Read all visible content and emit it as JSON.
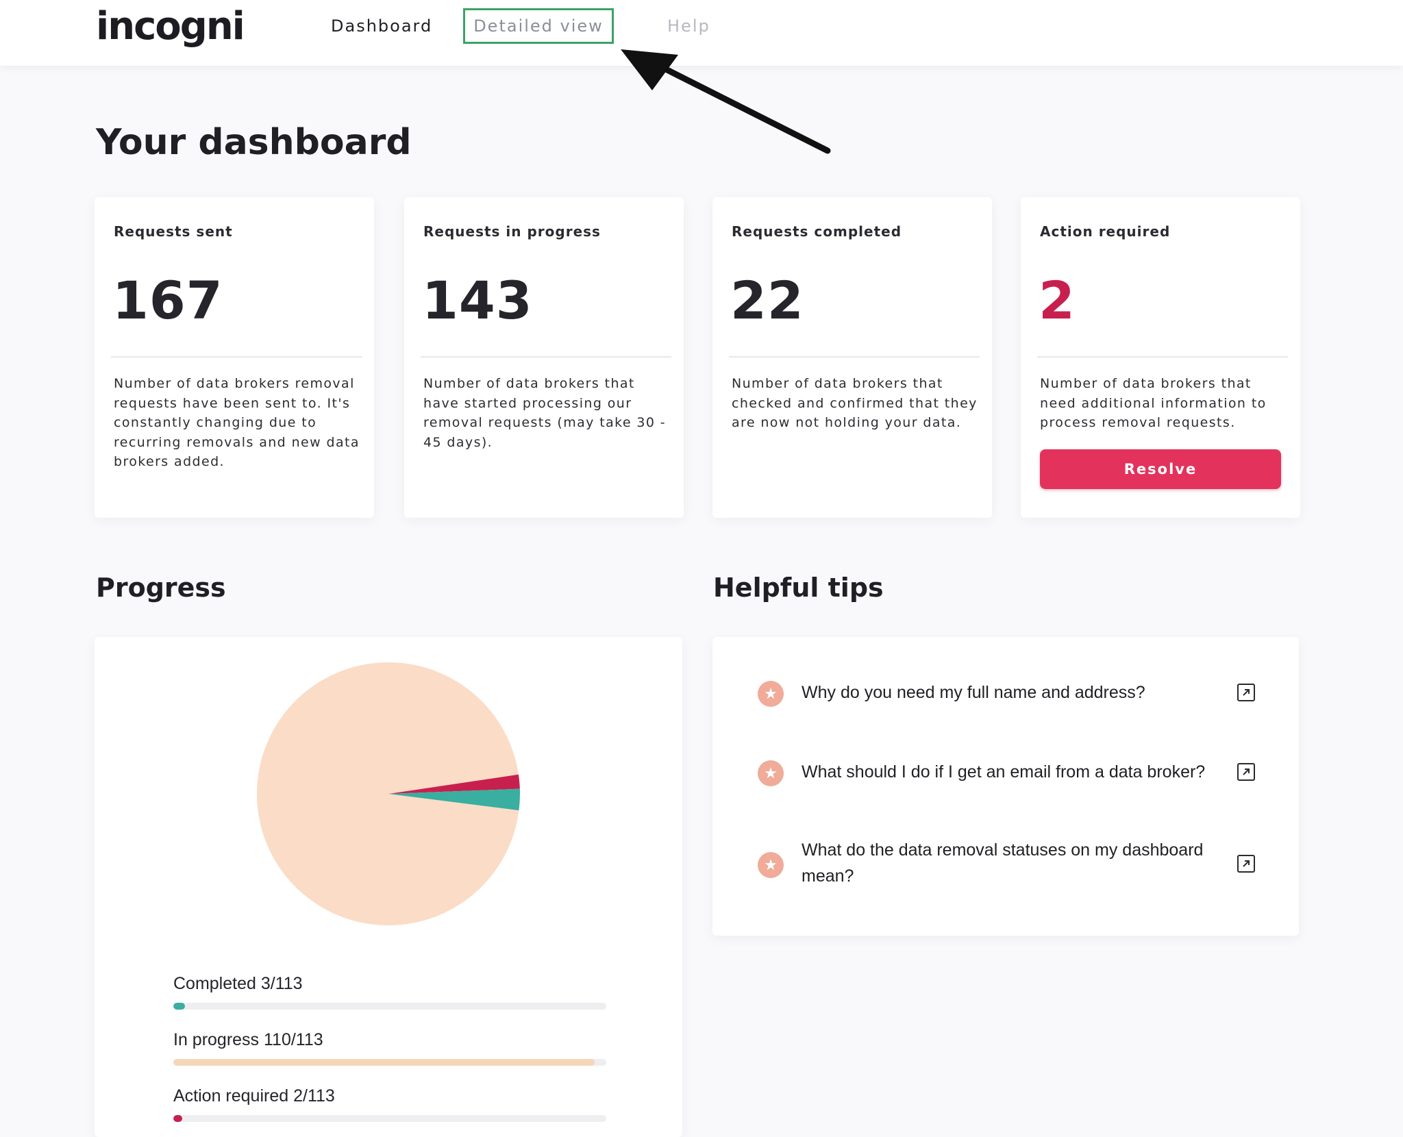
{
  "header": {
    "logo_text": "incogni",
    "nav": {
      "dashboard": "Dashboard",
      "detailed_view": "Detailed view",
      "help": "Help"
    }
  },
  "page": {
    "title": "Your dashboard"
  },
  "cards": [
    {
      "label": "Requests sent",
      "value": "167",
      "description": "Number of data brokers removal requests have been sent to. It's constantly changing due to recurring removals and new data brokers added."
    },
    {
      "label": "Requests in progress",
      "value": "143",
      "description": "Number of data brokers that have started processing our removal requests (may take 30 - 45 days)."
    },
    {
      "label": "Requests completed",
      "value": "22",
      "description": "Number of data brokers that checked and confirmed that they are now not holding your data."
    },
    {
      "label": "Action required",
      "value": "2",
      "description": "Number of data brokers that need additional information to process removal requests.",
      "button_label": "Resolve"
    }
  ],
  "progress": {
    "title": "Progress",
    "bars": [
      {
        "label": "Completed 3/113",
        "value": 3,
        "total": 113,
        "color": "#3aaea0"
      },
      {
        "label": "In progress 110/113",
        "value": 110,
        "total": 113,
        "color": "#f5d6b8"
      },
      {
        "label": "Action required 2/113",
        "value": 2,
        "total": 113,
        "color": "#c8204e"
      }
    ]
  },
  "chart_data": {
    "type": "pie",
    "slices": [
      {
        "label": "Completed",
        "value": 3,
        "color": "#3aaea0"
      },
      {
        "label": "In progress",
        "value": 110,
        "color": "#fbdcc6"
      },
      {
        "label": "Action required",
        "value": 2,
        "color": "#c8204e"
      }
    ]
  },
  "tips": {
    "title": "Helpful tips",
    "items": [
      {
        "text": "Why do you need my full name and address?"
      },
      {
        "text": "What should I do if I get an email from a data broker?"
      },
      {
        "text": "What do the data removal statuses on my dashboard mean?"
      }
    ]
  },
  "icons": {
    "star": "star-icon",
    "external": "external-link-icon",
    "arrow": "arrow-annotation"
  }
}
